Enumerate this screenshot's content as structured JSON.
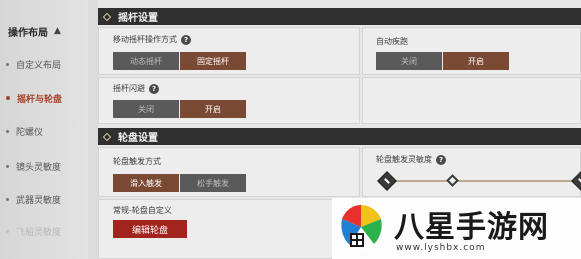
{
  "sidebar": {
    "header": "操作布局",
    "items": [
      {
        "label": "自定义布局",
        "state": "normal"
      },
      {
        "label": "摇杆与轮盘",
        "state": "active"
      },
      {
        "label": "陀螺仪",
        "state": "normal"
      },
      {
        "label": "镜头灵敏度",
        "state": "normal"
      },
      {
        "label": "武器灵敏度",
        "state": "normal"
      },
      {
        "label": "飞船灵敏度",
        "state": "faded"
      }
    ]
  },
  "joystick_section": {
    "title": "摇杆设置",
    "move_mode": {
      "label": "移动摇杆操作方式",
      "options": [
        "动态摇杆",
        "固定摇杆"
      ],
      "selected": 1
    },
    "auto_run": {
      "label": "自动疾跑",
      "options": [
        "关闭",
        "开启"
      ],
      "selected": 1
    },
    "joystick_dodge": {
      "label": "摇杆闪避",
      "options": [
        "关闭",
        "开启"
      ],
      "selected": 1
    }
  },
  "wheel_section": {
    "title": "轮盘设置",
    "trigger_mode": {
      "label": "轮盘触发方式",
      "options": [
        "滑入触发",
        "松手触发"
      ],
      "selected": 0
    },
    "sensitivity": {
      "label": "轮盘触发灵敏度",
      "value_fraction": 0.35
    },
    "custom": {
      "label": "常规-轮盘自定义",
      "button": "编辑轮盘"
    }
  },
  "watermark": {
    "title": "八星手游网",
    "url": "www.lyshbx.com"
  },
  "colors": {
    "section_bar": "#2f2f2f",
    "selected_option": "#7a4a34",
    "active_nav": "#a0452a",
    "edit_button": "#a2241f"
  }
}
